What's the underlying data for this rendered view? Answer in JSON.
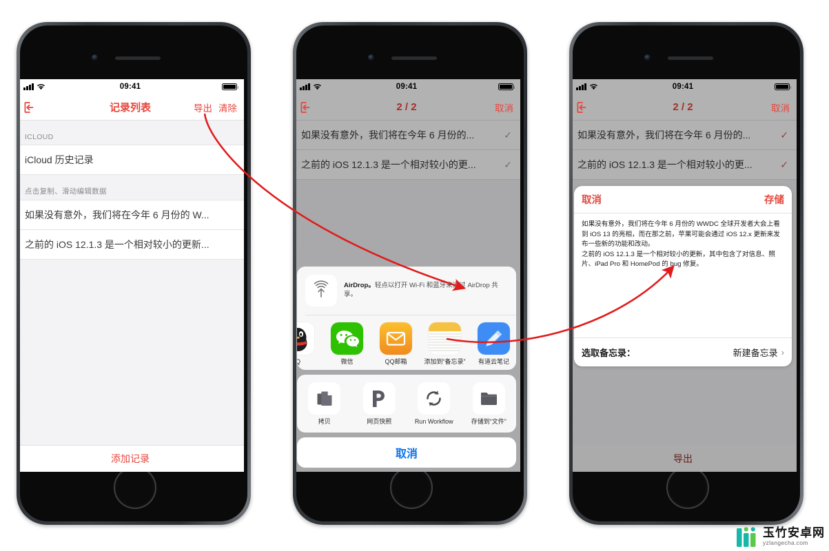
{
  "colors": {
    "accent_red": "#e8453c",
    "ios_blue": "#0a72e8",
    "check_gray": "#9a9a9e",
    "check_red": "#d4564b",
    "arrow_red": "#e01b1b"
  },
  "phones": [
    {
      "id": "phone-record-list",
      "status": {
        "time": "09:41"
      },
      "nav": {
        "back_icon": "exit-icon",
        "title": "记录列表",
        "actions": [
          "导出",
          "清除"
        ]
      },
      "sections": [
        {
          "header": "ICLOUD",
          "cells": [
            "iCloud 历史记录"
          ]
        },
        {
          "header": "点击复制、滑动编辑数据",
          "cells": [
            "如果没有意外，我们将在今年 6 月份的 W...",
            "之前的 iOS 12.1.3 是一个相对较小的更新..."
          ]
        }
      ],
      "bottom_action": "添加记录"
    },
    {
      "id": "phone-share-sheet",
      "status": {
        "time": "09:41"
      },
      "nav": {
        "back_icon": "exit-icon",
        "title": "2 / 2",
        "actions": [
          "取消"
        ]
      },
      "rows": [
        {
          "text": "如果没有意外，我们将在今年 6 月份的...",
          "check": "✓"
        },
        {
          "text": "之前的 iOS 12.1.3 是一个相对较小的更...",
          "check": "✓"
        }
      ],
      "airdrop": {
        "icon": "airdrop-icon",
        "title": "AirDrop。",
        "body": "轻点以打开 Wi-Fi 和蓝牙来通过 AirDrop 共享。"
      },
      "apps": [
        {
          "label": "Q",
          "icon": "qq-icon"
        },
        {
          "label": "微信",
          "icon": "wechat-icon"
        },
        {
          "label": "QQ邮箱",
          "icon": "qqmail-icon"
        },
        {
          "label": "添加到“备忘录”",
          "icon": "notes-icon"
        },
        {
          "label": "有道云笔记",
          "icon": "youdao-icon"
        }
      ],
      "actions": [
        {
          "label": "拷贝",
          "icon": "copy-icon"
        },
        {
          "label": "网页快照",
          "icon": "pocket-icon"
        },
        {
          "label": "Run Workflow",
          "icon": "workflow-icon"
        },
        {
          "label": "存储到“文件”",
          "icon": "folder-icon"
        }
      ],
      "cancel_label": "取消"
    },
    {
      "id": "phone-notes-compose",
      "status": {
        "time": "09:41"
      },
      "nav": {
        "back_icon": "exit-icon",
        "title": "2 / 2",
        "actions": [
          "取消"
        ]
      },
      "rows": [
        {
          "text": "如果没有意外，我们将在今年 6 月份的...",
          "check": "✓"
        },
        {
          "text": "之前的 iOS 12.1.3 是一个相对较小的更...",
          "check": "✓"
        }
      ],
      "note_sheet": {
        "cancel_label": "取消",
        "save_label": "存储",
        "body_p1": "如果没有意外，我们将在今年 6 月份的 WWDC 全球开发者大会上看到 iOS 13 的亮相，而在那之前，苹果可能会通过 iOS 12.x 更新来发布一些新的功能和改动。",
        "body_p2": "之前的 iOS 12.1.3 是一个相对较小的更新，其中包含了对信息、照片、iPad Pro 和 HomePod 的 bug 修复。",
        "picker_label": "选取备忘录：",
        "picker_value": "新建备忘录",
        "chevron": "›"
      },
      "bottom_action": "导出"
    }
  ],
  "watermark": {
    "title": "玉竹安卓网",
    "url": "yzlangecha.com"
  }
}
